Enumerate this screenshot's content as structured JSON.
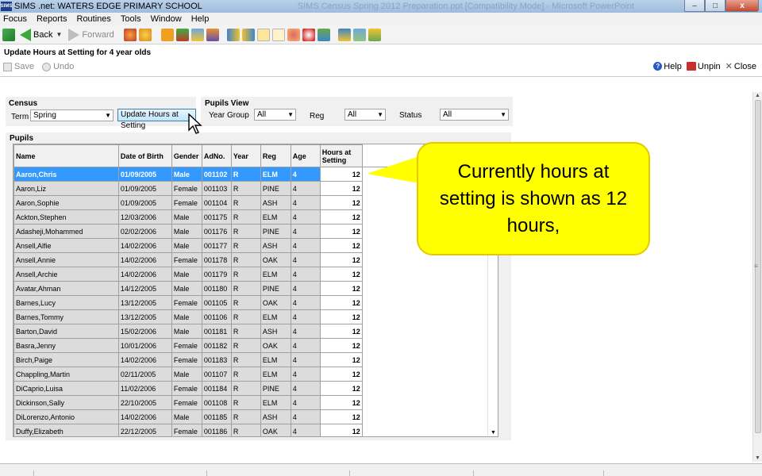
{
  "window": {
    "app_icon_text": "SIMS",
    "title": "SIMS .net: WATERS EDGE PRIMARY SCHOOL",
    "title_ghost": "SIMS Census Spring 2012 Preparation.ppt [Compatibility Mode] - Microsoft PowerPoint",
    "controls": {
      "minimize": "–",
      "maximize": "□",
      "close": "x"
    }
  },
  "menu": [
    "Focus",
    "Reports",
    "Routines",
    "Tools",
    "Window",
    "Help"
  ],
  "toolbar": {
    "back_label": "Back",
    "forward_label": "Forward",
    "icons": [
      "home-icon",
      "back-arrow-icon",
      "forward-arrow-icon",
      "people-icon",
      "person-icon",
      "book-icon",
      "flag-icon",
      "card-icon",
      "teacher-icon",
      "register-icon",
      "timetable-icon",
      "report-icon",
      "edit-icon",
      "pupil-icon",
      "clock-icon",
      "graph-icon",
      "exchange-icon",
      "group-icon",
      "folder-icon"
    ]
  },
  "page": {
    "title": "Update Hours at Setting for 4 year olds",
    "save_label": "Save",
    "undo_label": "Undo",
    "help_label": "Help",
    "unpin_label": "Unpin",
    "close_label": "Close"
  },
  "census": {
    "title": "Census",
    "term_label": "Term",
    "term_value": "Spring",
    "update_button": "Update Hours at Setting"
  },
  "pupils_view": {
    "title": "Pupils View",
    "year_group_label": "Year Group",
    "year_group_value": "All",
    "reg_label": "Reg",
    "reg_value": "All",
    "status_label": "Status",
    "status_value": "All"
  },
  "pupils": {
    "title": "Pupils",
    "columns": [
      "Name",
      "Date of Birth",
      "Gender",
      "AdNo.",
      "Year",
      "Reg",
      "Age",
      "Hours at Setting"
    ],
    "rows": [
      [
        "Aaron,Chris",
        "01/09/2005",
        "Male",
        "001102",
        "R",
        "ELM",
        "4",
        "12"
      ],
      [
        "Aaron,Liz",
        "01/09/2005",
        "Female",
        "001103",
        "R",
        "PINE",
        "4",
        "12"
      ],
      [
        "Aaron,Sophie",
        "01/09/2005",
        "Female",
        "001104",
        "R",
        "ASH",
        "4",
        "12"
      ],
      [
        "Ackton,Stephen",
        "12/03/2006",
        "Male",
        "001175",
        "R",
        "ELM",
        "4",
        "12"
      ],
      [
        "Adasheji,Mohammed",
        "02/02/2006",
        "Male",
        "001176",
        "R",
        "PINE",
        "4",
        "12"
      ],
      [
        "Ansell,Alfie",
        "14/02/2006",
        "Male",
        "001177",
        "R",
        "ASH",
        "4",
        "12"
      ],
      [
        "Ansell,Annie",
        "14/02/2006",
        "Female",
        "001178",
        "R",
        "OAK",
        "4",
        "12"
      ],
      [
        "Ansell,Archie",
        "14/02/2006",
        "Male",
        "001179",
        "R",
        "ELM",
        "4",
        "12"
      ],
      [
        "Avatar,Ahman",
        "14/12/2005",
        "Male",
        "001180",
        "R",
        "PINE",
        "4",
        "12"
      ],
      [
        "Barnes,Lucy",
        "13/12/2005",
        "Female",
        "001105",
        "R",
        "OAK",
        "4",
        "12"
      ],
      [
        "Barnes,Tommy",
        "13/12/2005",
        "Male",
        "001106",
        "R",
        "ELM",
        "4",
        "12"
      ],
      [
        "Barton,David",
        "15/02/2006",
        "Male",
        "001181",
        "R",
        "ASH",
        "4",
        "12"
      ],
      [
        "Basra,Jenny",
        "10/01/2006",
        "Female",
        "001182",
        "R",
        "OAK",
        "4",
        "12"
      ],
      [
        "Birch,Paige",
        "14/02/2006",
        "Female",
        "001183",
        "R",
        "ELM",
        "4",
        "12"
      ],
      [
        "Chappling,Martin",
        "02/11/2005",
        "Male",
        "001107",
        "R",
        "ELM",
        "4",
        "12"
      ],
      [
        "DiCaprio,Luisa",
        "11/02/2006",
        "Female",
        "001184",
        "R",
        "PINE",
        "4",
        "12"
      ],
      [
        "Dickinson,Sally",
        "22/10/2005",
        "Female",
        "001108",
        "R",
        "ELM",
        "4",
        "12"
      ],
      [
        "DiLorenzo,Antonio",
        "14/02/2006",
        "Male",
        "001185",
        "R",
        "ASH",
        "4",
        "12"
      ],
      [
        "Duffy,Elizabeth",
        "22/12/2005",
        "Female",
        "001186",
        "R",
        "OAK",
        "4",
        "12"
      ]
    ],
    "selected_row": 0
  },
  "callout": {
    "text": "Currently hours at setting is shown as 12 hours,"
  },
  "colors": {
    "selection": "#3399ff",
    "callout": "#ffff00",
    "panel": "#f0f0f0"
  }
}
